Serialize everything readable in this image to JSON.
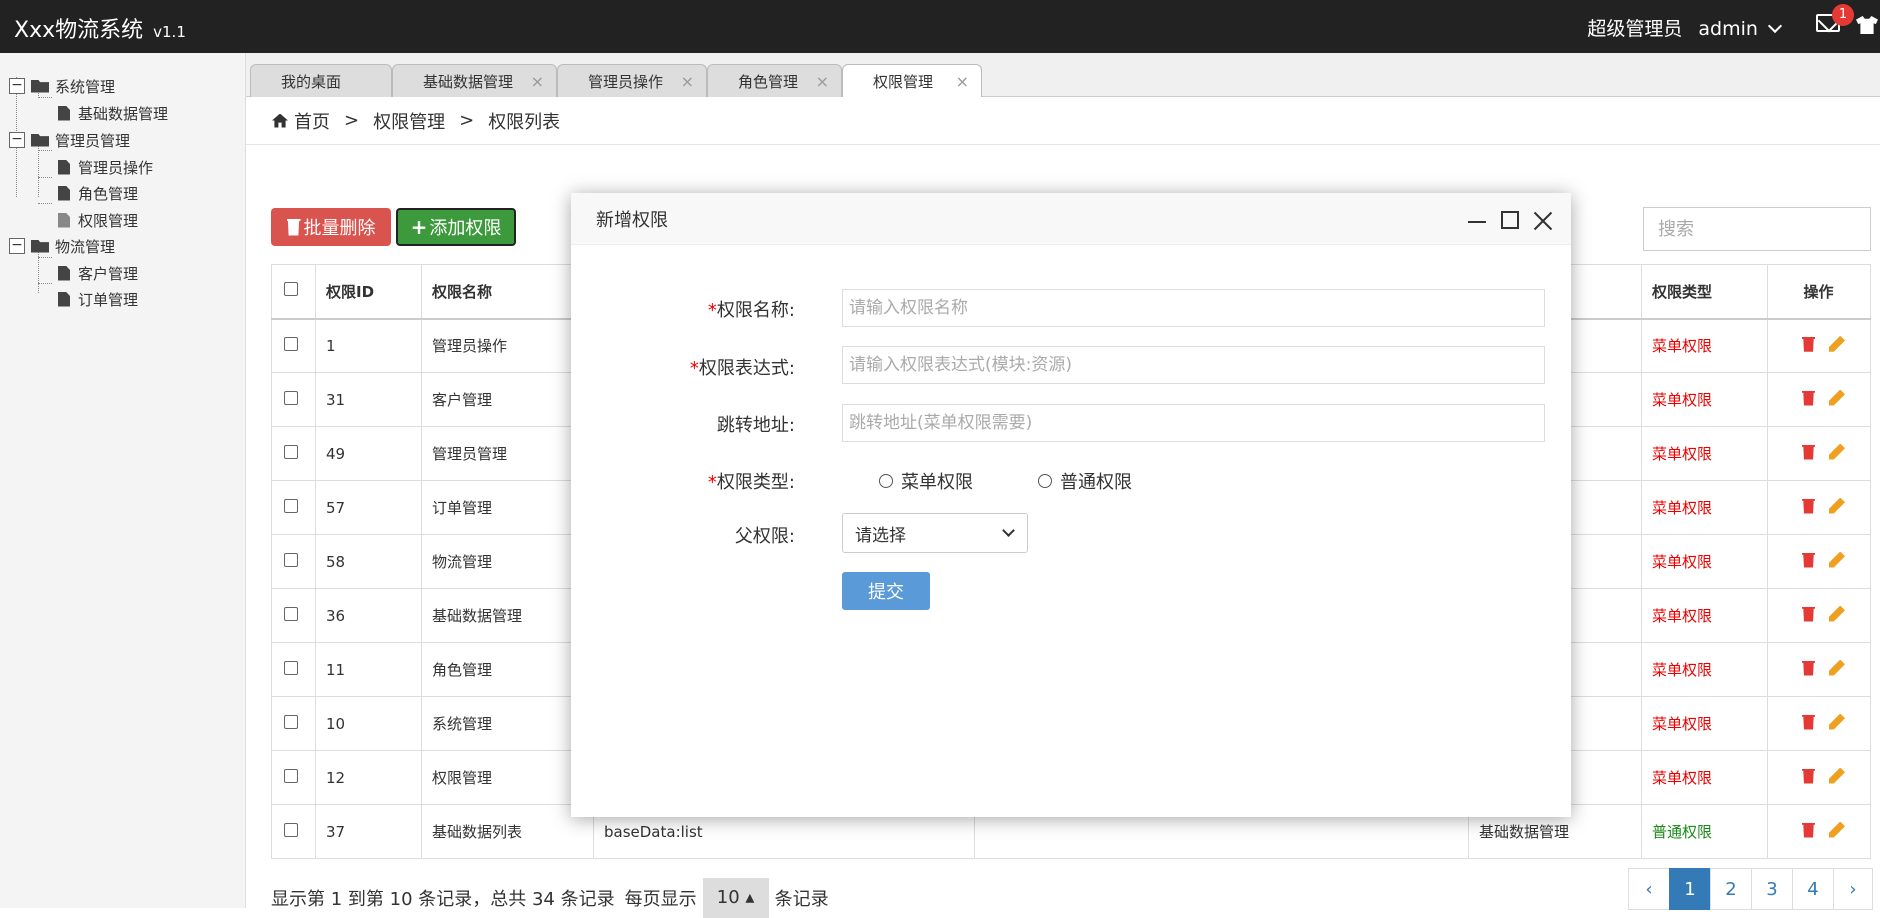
{
  "header": {
    "title": "Xxx物流系统",
    "version": "v1.1",
    "user_role": "超级管理员",
    "user_name": "admin",
    "mail_badge": "1"
  },
  "sidebar": {
    "nodes": [
      {
        "label": "系统管理",
        "toggle": "−"
      },
      {
        "label": "基础数据管理"
      },
      {
        "label": "管理员管理",
        "toggle": "−"
      },
      {
        "label": "管理员操作"
      },
      {
        "label": "角色管理"
      },
      {
        "label": "权限管理"
      },
      {
        "label": "物流管理",
        "toggle": "−"
      },
      {
        "label": "客户管理"
      },
      {
        "label": "订单管理"
      }
    ]
  },
  "tabs": [
    {
      "label": "我的桌面"
    },
    {
      "label": "基础数据管理"
    },
    {
      "label": "管理员操作"
    },
    {
      "label": "角色管理"
    },
    {
      "label": "权限管理"
    }
  ],
  "tab_close": "×",
  "breadcrumb": [
    "首页",
    "权限管理",
    "权限列表"
  ],
  "breadcrumb_sep": ">",
  "toolbar": {
    "delete_label": "批量删除",
    "add_label": "添加权限"
  },
  "search": {
    "placeholder": "搜索"
  },
  "table": {
    "headers": [
      "权限ID",
      "权限名称",
      "权限类型",
      "操作"
    ],
    "rows": [
      {
        "id": "1",
        "name": "管理员操作",
        "expr": "",
        "parent": "",
        "type": "菜单权限"
      },
      {
        "id": "31",
        "name": "客户管理",
        "expr": "",
        "parent": "",
        "type": "菜单权限"
      },
      {
        "id": "49",
        "name": "管理员管理",
        "expr": "",
        "parent": "",
        "type": "菜单权限"
      },
      {
        "id": "57",
        "name": "订单管理",
        "expr": "",
        "parent": "",
        "type": "菜单权限"
      },
      {
        "id": "58",
        "name": "物流管理",
        "expr": "",
        "parent": "",
        "type": "菜单权限"
      },
      {
        "id": "36",
        "name": "基础数据管理",
        "expr": "",
        "parent": "",
        "type": "菜单权限"
      },
      {
        "id": "11",
        "name": "角色管理",
        "expr": "",
        "parent": "",
        "type": "菜单权限"
      },
      {
        "id": "10",
        "name": "系统管理",
        "expr": "",
        "parent": "",
        "type": "菜单权限"
      },
      {
        "id": "12",
        "name": "权限管理",
        "expr": "",
        "parent": "",
        "type": "菜单权限"
      },
      {
        "id": "37",
        "name": "基础数据列表",
        "expr": "baseData:list",
        "parent": "基础数据管理",
        "type": "普通权限"
      }
    ]
  },
  "footer": {
    "info_prefix": "显示第 1 到第 10 条记录，总共 34 条记录",
    "per_page_label": "每页显示",
    "page_size": "10 ▴",
    "per_page_suffix": "条记录",
    "pages": [
      "‹",
      "1",
      "2",
      "3",
      "4",
      "›"
    ]
  },
  "modal": {
    "title": "新增权限",
    "required_mark": "*",
    "fields": {
      "name_label": "权限名称:",
      "name_placeholder": "请输入权限名称",
      "expr_label": "权限表达式:",
      "expr_placeholder": "请输入权限表达式(模块:资源)",
      "url_label": "跳转地址:",
      "url_placeholder": "跳转地址(菜单权限需要)",
      "type_label": "权限类型:",
      "type_option_menu": "菜单权限",
      "type_option_normal": "普通权限",
      "parent_label": "父权限:",
      "parent_value": "请选择"
    },
    "submit_label": "提交"
  },
  "colors": {
    "header_bg": "#222222",
    "danger": "#d9534f",
    "success": "#3c9a3c",
    "primary": "#337ab7",
    "menu_type": "#e00000",
    "normal_type": "#1a8a1a"
  }
}
